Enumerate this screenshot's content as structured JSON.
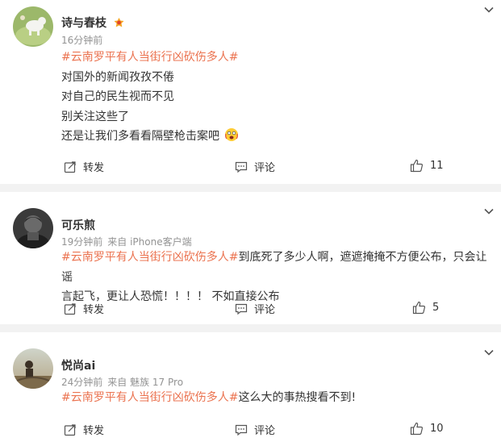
{
  "posts": [
    {
      "username": "诗与春枝",
      "time": "16分钟前",
      "source": "",
      "hashtag": "#云南罗平有人当街行凶砍伤多人#",
      "lines": [
        "对国外的新闻孜孜不倦",
        "对自己的民生视而不见",
        "别关注这些了",
        "还是让我们多看看隔壁枪击案吧"
      ],
      "repost_label": "转发",
      "comment_label": "评论",
      "like_count": "11"
    },
    {
      "username": "可乐煎",
      "time": "19分钟前",
      "source": "来自 iPhone客户端",
      "hashtag": "#云南罗平有人当街行凶砍伤多人#",
      "text_line1": "到底死了多少人啊，遮遮掩掩不方便公布，只会让谣",
      "text_line2": "言起飞，更让人恐慌！！！！ 不如直接公布",
      "repost_label": "转发",
      "comment_label": "评论",
      "like_count": "5"
    },
    {
      "username": "悦尚ai",
      "time": "24分钟前",
      "source": "来自 魅族 17 Pro",
      "hashtag": "#云南罗平有人当街行凶砍伤多人#",
      "text": "这么大的事热搜看不到!",
      "repost_label": "转发",
      "comment_label": "评论",
      "like_count": "10"
    }
  ],
  "colors": {
    "hashtag": "#eb7350",
    "meta": "#939393",
    "separator": "#f2f2f2"
  }
}
